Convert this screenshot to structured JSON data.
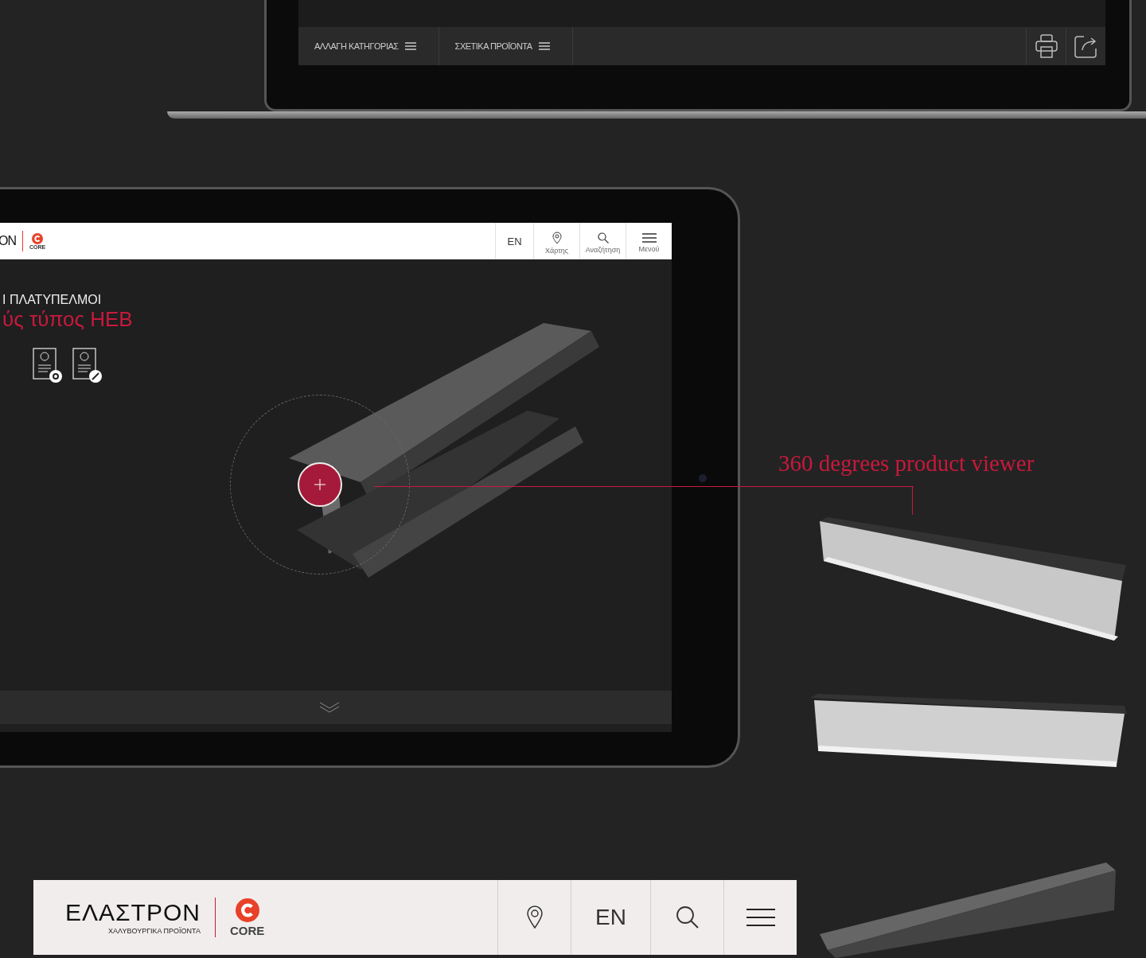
{
  "laptop": {
    "toolbar": {
      "menus": [
        {
          "label": "ΑΛΛΑΓΗ ΚΑΤΗΓΟΡΙΑΣ"
        },
        {
          "label": "ΣΧΕΤΙΚΑ ΠΡΟΪΟΝΤΑ"
        }
      ]
    }
  },
  "tablet": {
    "header": {
      "logo_text": "ON",
      "core_label": "CORE",
      "language": "EN",
      "actions": [
        {
          "label": "Χάρτης",
          "kind": "map"
        },
        {
          "label": "Αναζήτηση",
          "kind": "search"
        },
        {
          "label": "Μενού",
          "kind": "menu"
        }
      ]
    },
    "title": "Ι ΠΛΑΤΥΠΕΛΜΟΙ",
    "subtitle": "ύς τύπος HEB"
  },
  "annotation": "360 degrees product viewer",
  "mobile_header": {
    "logo_text": "ΕΛΑΣΤΡΟΝ",
    "tagline": "ΧΑΛΥΒΟΥΡΓΙΚΑ ΠΡΟΪΟΝΤΑ",
    "core_label": "CORE",
    "language": "EN"
  }
}
